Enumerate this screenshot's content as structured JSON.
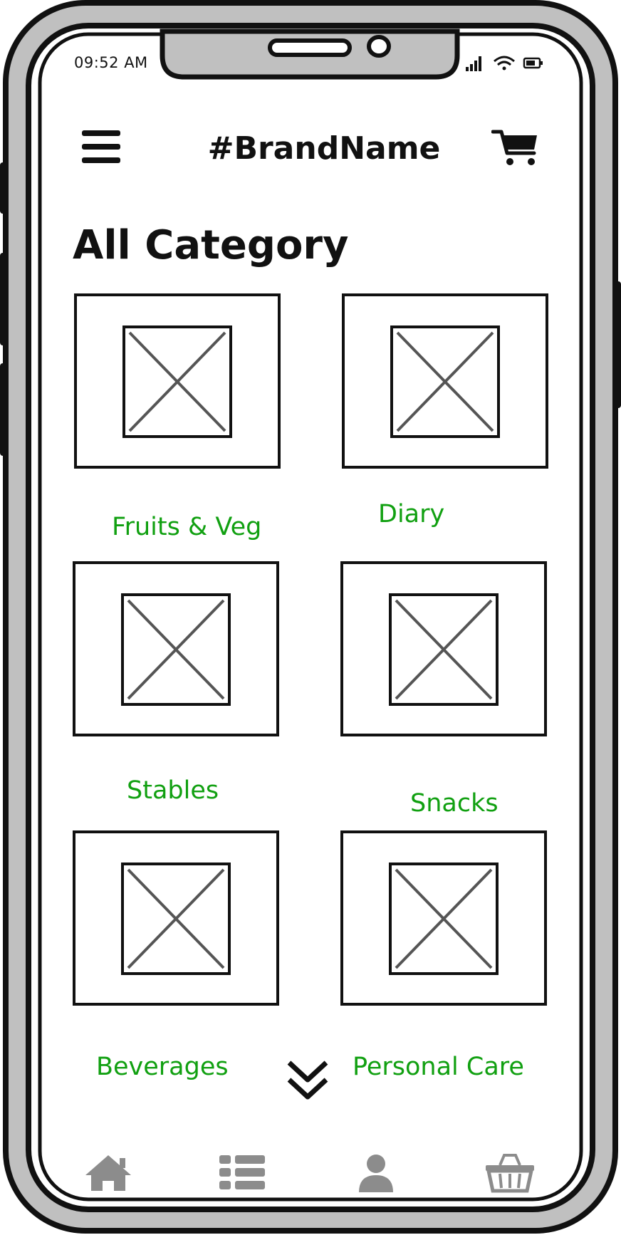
{
  "status_bar": {
    "time": "09:52 AM",
    "icons": [
      "signal-icon",
      "wifi-icon",
      "battery-icon"
    ]
  },
  "header": {
    "menu_icon": "hamburger-menu-icon",
    "brand": "#BrandName",
    "cart_icon": "cart-icon"
  },
  "main": {
    "title": "All Category",
    "categories": [
      {
        "label": "Fruits & Veg",
        "image": "image-placeholder"
      },
      {
        "label": "Diary",
        "image": "image-placeholder"
      },
      {
        "label": "Stables",
        "image": "image-placeholder"
      },
      {
        "label": "Snacks",
        "image": "image-placeholder"
      },
      {
        "label": "Beverages",
        "image": "image-placeholder"
      },
      {
        "label": "Personal Care",
        "image": "image-placeholder"
      }
    ],
    "more_icon": "chevron-double-down-icon"
  },
  "tab_bar": {
    "items": [
      {
        "icon": "home-icon"
      },
      {
        "icon": "list-icon"
      },
      {
        "icon": "user-icon"
      },
      {
        "icon": "basket-icon"
      }
    ]
  },
  "colors": {
    "category_label": "#11a011",
    "frame": "#bfbfbf",
    "outline": "#111111",
    "tab_icon": "#8c8c8c",
    "placeholder": "#555555"
  }
}
